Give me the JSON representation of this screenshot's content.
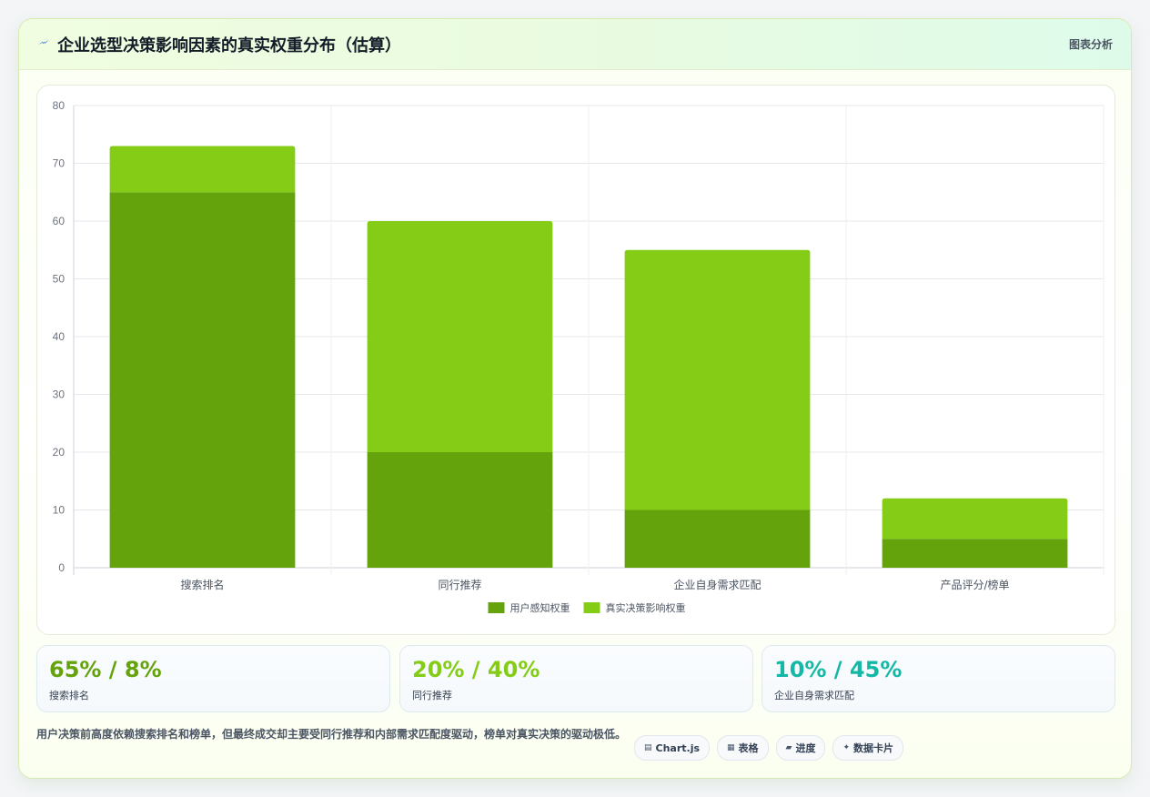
{
  "header": {
    "title": "企业选型决策影响因素的真实权重分布（估算）",
    "tag": "图表分析",
    "logo_icon": "bolt-icon"
  },
  "chart_data": {
    "type": "bar",
    "stacked": true,
    "categories": [
      "搜索排名",
      "同行推荐",
      "企业自身需求匹配",
      "产品评分/榜单"
    ],
    "series": [
      {
        "name": "用户感知权重",
        "values": [
          65,
          20,
          10,
          5
        ],
        "color": "#65a30d"
      },
      {
        "name": "真实决策影响权重",
        "values": [
          8,
          40,
          45,
          7
        ],
        "color": "#84cc16"
      }
    ],
    "ylim": [
      0,
      80
    ],
    "yticks": [
      0,
      10,
      20,
      30,
      40,
      50,
      60,
      70,
      80
    ],
    "grid": true,
    "legend": "bottom"
  },
  "stats": [
    {
      "value": "65% / 8%",
      "label": "搜索排名",
      "color": "#65a30d"
    },
    {
      "value": "20% / 40%",
      "label": "同行推荐",
      "color": "#84cc16"
    },
    {
      "value": "10% / 45%",
      "label": "企业自身需求匹配",
      "color": "#14b8a6"
    }
  ],
  "summary": "用户决策前高度依赖搜索排名和榜单，但最终成交却主要受同行推荐和内部需求匹配度驱动，榜单对真实决策的驱动极低。",
  "pills": [
    {
      "icon": "▤",
      "label": "Chart.js"
    },
    {
      "icon": "▦",
      "label": "表格"
    },
    {
      "icon": "▰",
      "label": "进度"
    },
    {
      "icon": "✦",
      "label": "数据卡片"
    }
  ]
}
